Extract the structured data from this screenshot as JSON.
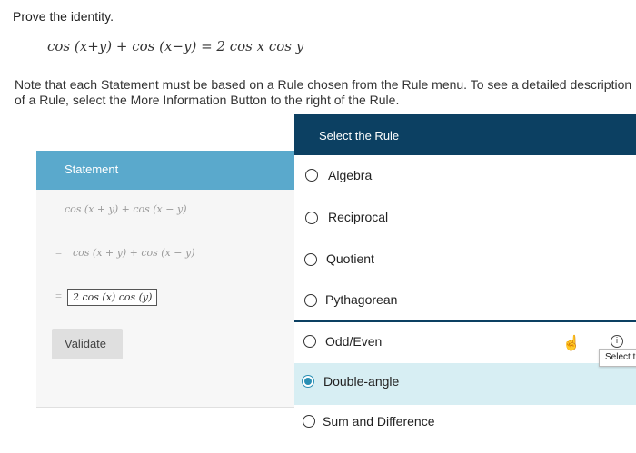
{
  "prompt": {
    "title": "Prove the identity.",
    "identity": "cos (x+y) + cos (x−y) = 2 cos x cos y",
    "note": "Note that each Statement must be based on a Rule chosen from the Rule menu. To see a detailed description of a Rule, select the More Information Button to the right of the Rule."
  },
  "statement_panel": {
    "header": "Statement",
    "rows": [
      {
        "expression": "cos (x + y) + cos (x − y)"
      },
      {
        "prefix": "=",
        "expression": "cos (x + y) + cos (x − y)"
      },
      {
        "prefix": "=",
        "expression": "2 cos (x) cos (y)"
      }
    ],
    "validate_label": "Validate"
  },
  "rule_panel": {
    "header": "Select the Rule",
    "rules": [
      {
        "label": "Algebra",
        "selected": false
      },
      {
        "label": "Reciprocal",
        "selected": false
      },
      {
        "label": "Quotient",
        "selected": false
      },
      {
        "label": "Pythagorean",
        "selected": false
      },
      {
        "label": "Odd/Even",
        "selected": false
      },
      {
        "label": "Double-angle",
        "selected": true
      },
      {
        "label": "Sum and Difference",
        "selected": false
      }
    ]
  },
  "tooltip": {
    "text": "Select the Rule",
    "info_glyph": "i",
    "cursor_icon": "hand-pointer-icon"
  },
  "colors": {
    "statement_header": "#5aa9cc",
    "rule_header": "#0c4062",
    "selected_row": "#d7eef3"
  }
}
